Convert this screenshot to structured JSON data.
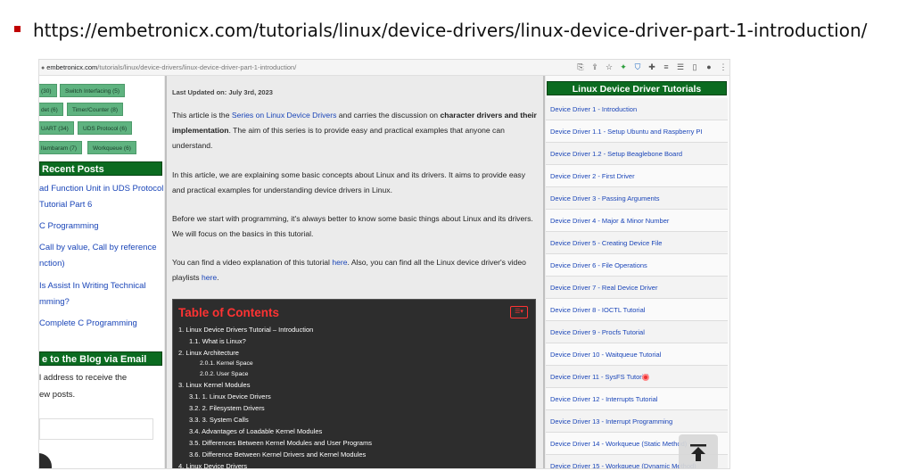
{
  "slide": {
    "url": "https://embetronicx.com/tutorials/linux/device-drivers/linux-device-driver-part-1-introduction/"
  },
  "browser": {
    "address_domain": "embetronicx.com",
    "address_path": "/tutorials/linux/device-drivers/linux-device-driver-part-1-introduction/",
    "toolbar_icons": [
      "translate-icon",
      "share-icon",
      "star-icon",
      "extension-icon",
      "shield-icon",
      "puzzle-icon",
      "pin-icon",
      "reading-list-icon",
      "sidebar-icon",
      "profile-icon",
      "menu-icon"
    ]
  },
  "left_sidebar": {
    "tags_row1": [
      "(30)",
      "Switch Interfacing (5)"
    ],
    "tags_row2": [
      "det (6)",
      "Timer/Counter (8)"
    ],
    "tags_row3": [
      "UART (34)",
      "UDS Protocol (6)"
    ],
    "tags_row4": [
      "llambaram (7)",
      "Workqueue (6)"
    ],
    "recent_posts_title": "Recent Posts",
    "recent_posts": [
      "ad Function Unit in UDS Protocol",
      "Tutorial Part 6",
      "C Programming",
      "Call by value, Call by reference",
      "nction)",
      "Is Assist In Writing Technical",
      "mming?",
      "Complete C Programming"
    ],
    "subscribe_title": "e to the Blog via Email",
    "subscribe_line1": "l address to receive the",
    "subscribe_line2": "ew posts."
  },
  "article": {
    "updated": "Last Updated on: July 3rd, 2023",
    "p1_a": "This article is the ",
    "p1_link": "Series on Linux Device Drivers",
    "p1_b": " and carries the discussion on ",
    "p1_bold": "character drivers and their implementation",
    "p1_c": ". The aim of this series is to provide easy and practical examples that anyone can understand.",
    "p2": "In this article, we are explaining some basic concepts about Linux and its drivers. It aims to provide easy and practical examples for understanding device drivers in Linux.",
    "p3": "Before we start with programming, it's always better to know some basic things about Linux and its drivers. We will focus on the basics in this tutorial.",
    "p4_a": "You can find a video explanation of this tutorial ",
    "p4_link1": "here",
    "p4_b": ". Also, you can find all the Linux device driver's video playlists ",
    "p4_link2": "here",
    "p4_c": "."
  },
  "toc": {
    "title": "Table of Contents",
    "items": [
      "1. Linux Device Drivers Tutorial – Introduction",
      "1.1. What is Linux?",
      "2. Linux Architecture",
      "2.0.1. Kernel Space",
      "2.0.2. User Space",
      "3. Linux Kernel Modules",
      "3.1. 1. Linux Device Drivers",
      "3.2. 2. Filesystem Drivers",
      "3.3. 3. System Calls",
      "3.4. Advantages of Loadable Kernel Modules",
      "3.5. Differences Between Kernel Modules and User Programs",
      "3.6. Difference Between Kernel Drivers and Kernel Modules",
      "4. Linux Device Drivers"
    ]
  },
  "right_sidebar": {
    "title": "Linux Device Driver Tutorials",
    "items": [
      "Device Driver 1 - Introduction",
      "Device Driver 1.1 - Setup Ubuntu and Raspberry PI",
      "Device Driver 1.2 - Setup Beaglebone Board",
      "Device Driver 2 - First Driver",
      "Device Driver 3 - Passing Arguments",
      "Device Driver 4 - Major & Minor Number",
      "Device Driver 5 - Creating Device File",
      "Device Driver 6 - File Operations",
      "Device Driver 7 - Real Device Driver",
      "Device Driver 8 - IOCTL Tutorial",
      "Device Driver 9 - Procfs Tutorial",
      "Device Driver 10 - Waitqueue Tutorial",
      "Device Driver 11 - SysFS Tutorial",
      "Device Driver 12 - Interrupts Tutorial",
      "Device Driver 13 - Interrupt Programming",
      "Device Driver 14 - Workqueue (Static Method)",
      "Device Driver 15 - Workqueue (Dynamic Method)"
    ]
  }
}
